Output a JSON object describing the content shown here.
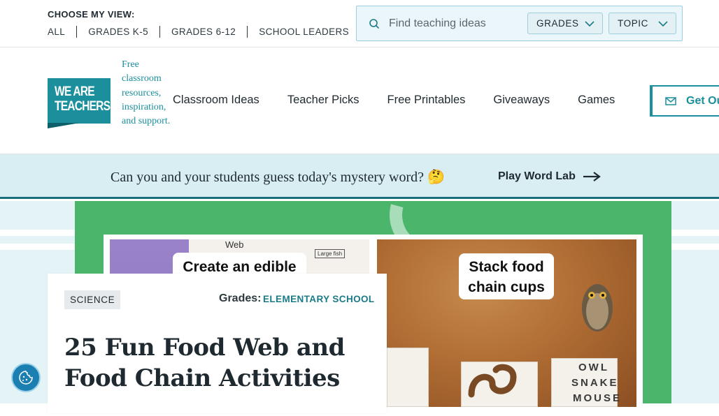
{
  "topbar": {
    "view_label": "CHOOSE MY VIEW:",
    "view_links": [
      "ALL",
      "GRADES K-5",
      "GRADES 6-12",
      "SCHOOL LEADERS"
    ],
    "search_placeholder": "Find teaching ideas",
    "grades_select": "GRADES",
    "topic_select": "TOPIC"
  },
  "header": {
    "logo_line1": "WE ARE",
    "logo_line2": "TEACHERS",
    "tagline": "Free classroom resources, inspiration, and support.",
    "nav": [
      "Classroom Ideas",
      "Teacher Picks",
      "Free Printables",
      "Giveaways",
      "Games"
    ],
    "cta_label": "Get Ou"
  },
  "banner": {
    "text": "Can you and your students guess today's mystery word? 🤔",
    "link_label": "Play Word Lab"
  },
  "hero": {
    "caption_left": "Create an edible",
    "caption_right_line1": "Stack food",
    "caption_right_line2": "chain cups",
    "cup_labels": [
      "OWL",
      "SNAKE",
      "MOUSE"
    ],
    "paper_words": [
      "Web",
      "Large fish"
    ]
  },
  "article": {
    "category": "SCIENCE",
    "grades_label": "Grades:",
    "grades_value": "ELEMENTARY SCHOOL",
    "title": "25 Fun Food Web and Food Chain Activities"
  },
  "colors": {
    "brand": "#1b8f9c",
    "banner_bg": "#d8eef3",
    "hero_green": "#4cb56c"
  }
}
